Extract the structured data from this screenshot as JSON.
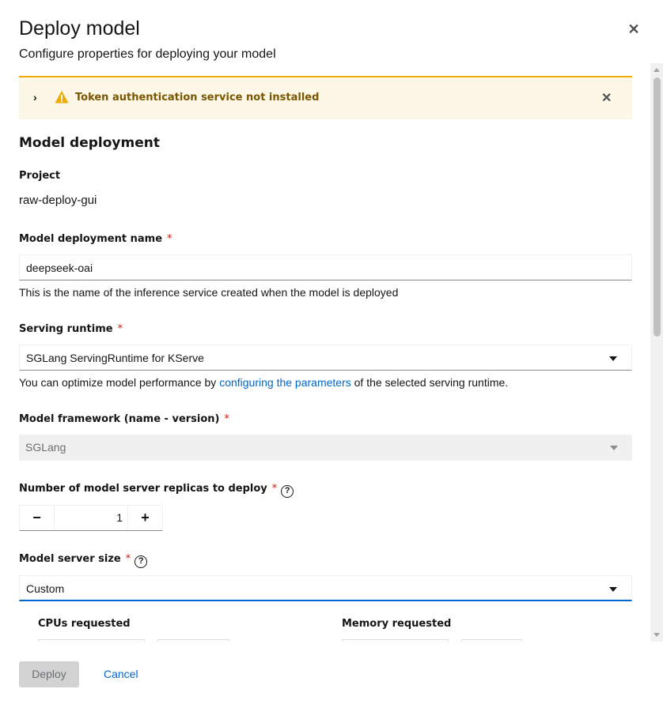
{
  "modal": {
    "title": "Deploy model",
    "description": "Configure properties for deploying your model"
  },
  "alert": {
    "text": "Token authentication service not installed",
    "type": "warning",
    "color": "#f0ab00"
  },
  "section": {
    "title": "Model deployment"
  },
  "project": {
    "label": "Project",
    "value": "raw-deploy-gui"
  },
  "deployment_name": {
    "label": "Model deployment name",
    "required": "*",
    "value": "deepseek-oai",
    "helper": "This is the name of the inference service created when the model is deployed"
  },
  "serving_runtime": {
    "label": "Serving runtime",
    "required": "*",
    "selected": "SGLang ServingRuntime for KServe",
    "helper_before": "You can optimize model performance by ",
    "helper_link": "configuring the parameters",
    "helper_after": " of the selected serving runtime."
  },
  "model_framework": {
    "label": "Model framework (name - version)",
    "required": "*",
    "selected": "SGLang"
  },
  "replicas": {
    "label": "Number of model server replicas to deploy",
    "required": "*",
    "help": "?",
    "value": "1",
    "minus": "−",
    "plus": "+"
  },
  "server_size": {
    "label": "Model server size",
    "required": "*",
    "help": "?",
    "selected": "Custom",
    "cpus_label": "CPUs requested",
    "memory_label": "Memory requested"
  },
  "footer": {
    "deploy_label": "Deploy",
    "cancel_label": "Cancel"
  },
  "colors": {
    "link": "#0066cc",
    "required": "#c9190b",
    "alert_bg": "#fdf7e7",
    "alert_text": "#795600",
    "active_border": "#0066cc"
  }
}
